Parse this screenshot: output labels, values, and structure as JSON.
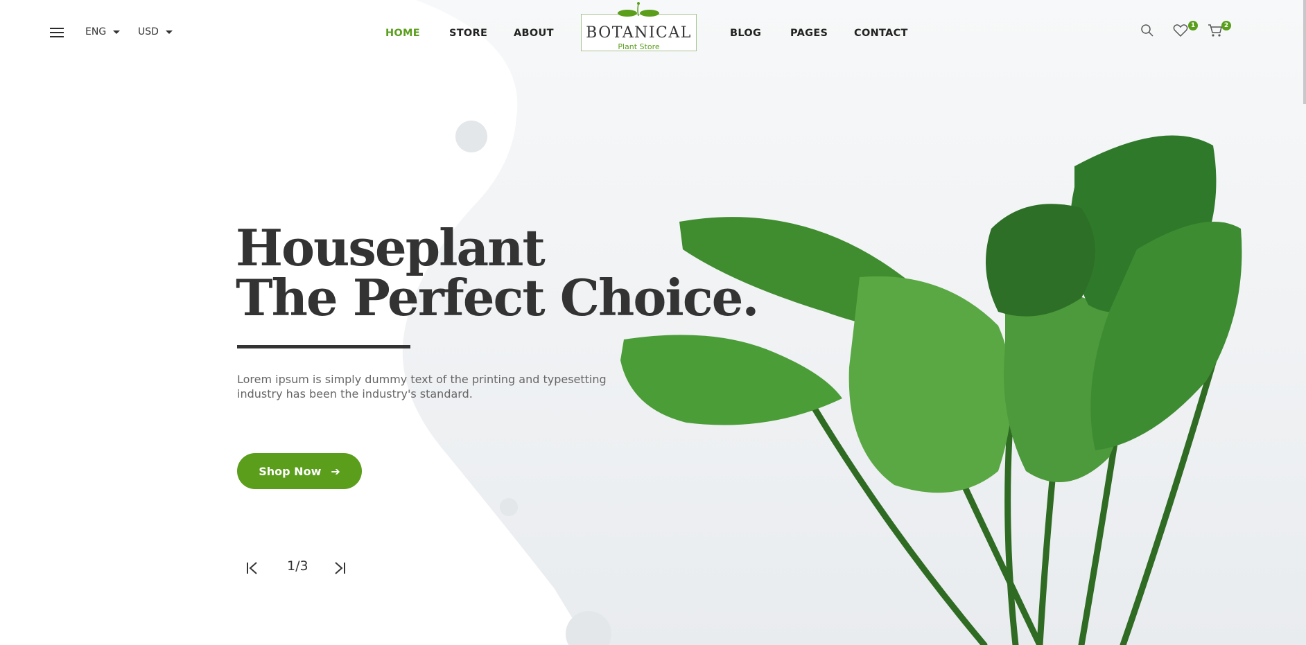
{
  "header": {
    "menu_icon": "hamburger-menu-icon",
    "language": "ENG",
    "currency": "USD",
    "nav": [
      {
        "label": "HOME",
        "active": true
      },
      {
        "label": "STORE",
        "active": false
      },
      {
        "label": "ABOUT",
        "active": false
      },
      {
        "label": "BLOG",
        "active": false
      },
      {
        "label": "PAGES",
        "active": false
      },
      {
        "label": "CONTACT",
        "active": false
      }
    ],
    "logo": {
      "title": "BOTANICAL",
      "subtitle": "Plant Store"
    },
    "icons": {
      "search": "search-icon",
      "wishlist": "heart-icon",
      "cart": "cart-icon"
    },
    "wishlist_count": "1",
    "cart_count": "2"
  },
  "hero": {
    "title_line1": "Houseplant",
    "title_line2": "The Perfect Choice.",
    "description": "Lorem ipsum is simply dummy text of the printing and typesetting industry has been the industry's standard.",
    "cta_label": "Shop Now",
    "cta_icon": "arrow-right-icon",
    "pager_current": "1",
    "pager_separator": "/",
    "pager_total": "3",
    "prev_icon": "first-slide-icon",
    "next_icon": "last-slide-icon"
  },
  "colors": {
    "accent": "#5a9e1c",
    "text": "#333333",
    "muted": "#666666",
    "background_shape": "#eef0f3"
  }
}
